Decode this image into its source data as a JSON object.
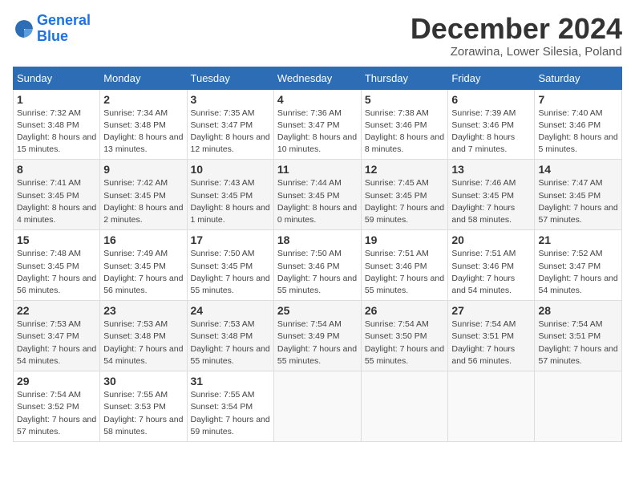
{
  "logo": {
    "line1": "General",
    "line2": "Blue"
  },
  "title": "December 2024",
  "subtitle": "Zorawina, Lower Silesia, Poland",
  "days_header": [
    "Sunday",
    "Monday",
    "Tuesday",
    "Wednesday",
    "Thursday",
    "Friday",
    "Saturday"
  ],
  "weeks": [
    [
      {
        "num": "1",
        "sunrise": "Sunrise: 7:32 AM",
        "sunset": "Sunset: 3:48 PM",
        "daylight": "Daylight: 8 hours and 15 minutes."
      },
      {
        "num": "2",
        "sunrise": "Sunrise: 7:34 AM",
        "sunset": "Sunset: 3:48 PM",
        "daylight": "Daylight: 8 hours and 13 minutes."
      },
      {
        "num": "3",
        "sunrise": "Sunrise: 7:35 AM",
        "sunset": "Sunset: 3:47 PM",
        "daylight": "Daylight: 8 hours and 12 minutes."
      },
      {
        "num": "4",
        "sunrise": "Sunrise: 7:36 AM",
        "sunset": "Sunset: 3:47 PM",
        "daylight": "Daylight: 8 hours and 10 minutes."
      },
      {
        "num": "5",
        "sunrise": "Sunrise: 7:38 AM",
        "sunset": "Sunset: 3:46 PM",
        "daylight": "Daylight: 8 hours and 8 minutes."
      },
      {
        "num": "6",
        "sunrise": "Sunrise: 7:39 AM",
        "sunset": "Sunset: 3:46 PM",
        "daylight": "Daylight: 8 hours and 7 minutes."
      },
      {
        "num": "7",
        "sunrise": "Sunrise: 7:40 AM",
        "sunset": "Sunset: 3:46 PM",
        "daylight": "Daylight: 8 hours and 5 minutes."
      }
    ],
    [
      {
        "num": "8",
        "sunrise": "Sunrise: 7:41 AM",
        "sunset": "Sunset: 3:45 PM",
        "daylight": "Daylight: 8 hours and 4 minutes."
      },
      {
        "num": "9",
        "sunrise": "Sunrise: 7:42 AM",
        "sunset": "Sunset: 3:45 PM",
        "daylight": "Daylight: 8 hours and 2 minutes."
      },
      {
        "num": "10",
        "sunrise": "Sunrise: 7:43 AM",
        "sunset": "Sunset: 3:45 PM",
        "daylight": "Daylight: 8 hours and 1 minute."
      },
      {
        "num": "11",
        "sunrise": "Sunrise: 7:44 AM",
        "sunset": "Sunset: 3:45 PM",
        "daylight": "Daylight: 8 hours and 0 minutes."
      },
      {
        "num": "12",
        "sunrise": "Sunrise: 7:45 AM",
        "sunset": "Sunset: 3:45 PM",
        "daylight": "Daylight: 7 hours and 59 minutes."
      },
      {
        "num": "13",
        "sunrise": "Sunrise: 7:46 AM",
        "sunset": "Sunset: 3:45 PM",
        "daylight": "Daylight: 7 hours and 58 minutes."
      },
      {
        "num": "14",
        "sunrise": "Sunrise: 7:47 AM",
        "sunset": "Sunset: 3:45 PM",
        "daylight": "Daylight: 7 hours and 57 minutes."
      }
    ],
    [
      {
        "num": "15",
        "sunrise": "Sunrise: 7:48 AM",
        "sunset": "Sunset: 3:45 PM",
        "daylight": "Daylight: 7 hours and 56 minutes."
      },
      {
        "num": "16",
        "sunrise": "Sunrise: 7:49 AM",
        "sunset": "Sunset: 3:45 PM",
        "daylight": "Daylight: 7 hours and 56 minutes."
      },
      {
        "num": "17",
        "sunrise": "Sunrise: 7:50 AM",
        "sunset": "Sunset: 3:45 PM",
        "daylight": "Daylight: 7 hours and 55 minutes."
      },
      {
        "num": "18",
        "sunrise": "Sunrise: 7:50 AM",
        "sunset": "Sunset: 3:46 PM",
        "daylight": "Daylight: 7 hours and 55 minutes."
      },
      {
        "num": "19",
        "sunrise": "Sunrise: 7:51 AM",
        "sunset": "Sunset: 3:46 PM",
        "daylight": "Daylight: 7 hours and 55 minutes."
      },
      {
        "num": "20",
        "sunrise": "Sunrise: 7:51 AM",
        "sunset": "Sunset: 3:46 PM",
        "daylight": "Daylight: 7 hours and 54 minutes."
      },
      {
        "num": "21",
        "sunrise": "Sunrise: 7:52 AM",
        "sunset": "Sunset: 3:47 PM",
        "daylight": "Daylight: 7 hours and 54 minutes."
      }
    ],
    [
      {
        "num": "22",
        "sunrise": "Sunrise: 7:53 AM",
        "sunset": "Sunset: 3:47 PM",
        "daylight": "Daylight: 7 hours and 54 minutes."
      },
      {
        "num": "23",
        "sunrise": "Sunrise: 7:53 AM",
        "sunset": "Sunset: 3:48 PM",
        "daylight": "Daylight: 7 hours and 54 minutes."
      },
      {
        "num": "24",
        "sunrise": "Sunrise: 7:53 AM",
        "sunset": "Sunset: 3:48 PM",
        "daylight": "Daylight: 7 hours and 55 minutes."
      },
      {
        "num": "25",
        "sunrise": "Sunrise: 7:54 AM",
        "sunset": "Sunset: 3:49 PM",
        "daylight": "Daylight: 7 hours and 55 minutes."
      },
      {
        "num": "26",
        "sunrise": "Sunrise: 7:54 AM",
        "sunset": "Sunset: 3:50 PM",
        "daylight": "Daylight: 7 hours and 55 minutes."
      },
      {
        "num": "27",
        "sunrise": "Sunrise: 7:54 AM",
        "sunset": "Sunset: 3:51 PM",
        "daylight": "Daylight: 7 hours and 56 minutes."
      },
      {
        "num": "28",
        "sunrise": "Sunrise: 7:54 AM",
        "sunset": "Sunset: 3:51 PM",
        "daylight": "Daylight: 7 hours and 57 minutes."
      }
    ],
    [
      {
        "num": "29",
        "sunrise": "Sunrise: 7:54 AM",
        "sunset": "Sunset: 3:52 PM",
        "daylight": "Daylight: 7 hours and 57 minutes."
      },
      {
        "num": "30",
        "sunrise": "Sunrise: 7:55 AM",
        "sunset": "Sunset: 3:53 PM",
        "daylight": "Daylight: 7 hours and 58 minutes."
      },
      {
        "num": "31",
        "sunrise": "Sunrise: 7:55 AM",
        "sunset": "Sunset: 3:54 PM",
        "daylight": "Daylight: 7 hours and 59 minutes."
      },
      null,
      null,
      null,
      null
    ]
  ]
}
